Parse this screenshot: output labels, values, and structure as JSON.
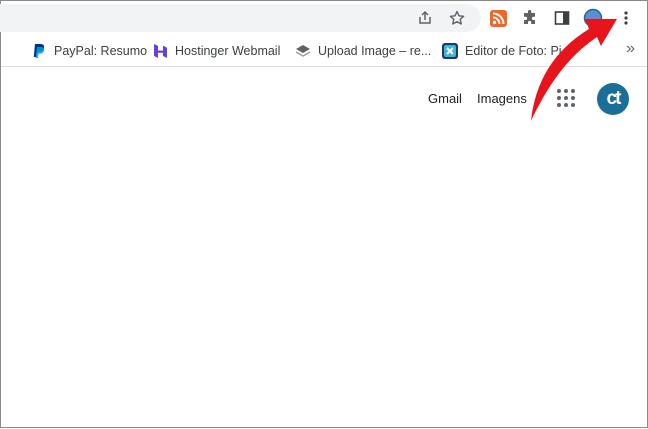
{
  "toolbar": {
    "icons": [
      "share-icon",
      "bookmark-star-icon",
      "rss-extension-icon",
      "extensions-puzzle-icon",
      "side-panel-icon",
      "profile-icon",
      "menu-kebab-icon"
    ]
  },
  "bookmarks": {
    "items": [
      {
        "label": "PayPal: Resumo",
        "icon": "paypal-icon"
      },
      {
        "label": "Hostinger Webmail",
        "icon": "hostinger-icon"
      },
      {
        "label": "Upload Image – re...",
        "icon": "layers-icon"
      },
      {
        "label": "Editor de Foto: Pi",
        "icon": "pixlr-icon"
      }
    ],
    "overflow_label": "»"
  },
  "google_bar": {
    "gmail_label": "Gmail",
    "images_label": "Imagens",
    "avatar_text": "ct"
  },
  "colors": {
    "accent_arrow": "#e8141b",
    "avatar_bg": "#1a6f9a",
    "rss_orange": "#f26522"
  }
}
